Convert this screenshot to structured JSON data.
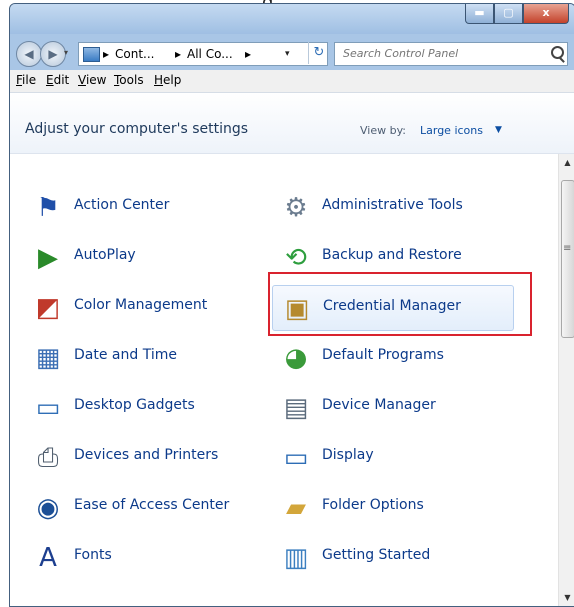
{
  "top_strip_text": "g",
  "window": {
    "buttons": {
      "minimize": "▬",
      "maximize": "▢",
      "close": "x"
    }
  },
  "address": {
    "back_icon": "back-arrow-icon",
    "forward_icon": "forward-arrow-icon",
    "crumbs": [
      "Cont...",
      "All Co..."
    ],
    "separator": "▸",
    "dropdown_arrow": "▾",
    "refresh_icon": "↻",
    "search_placeholder": "Search Control Panel"
  },
  "menu": [
    "File",
    "Edit",
    "View",
    "Tools",
    "Help"
  ],
  "header": {
    "title": "Adjust your computer's settings",
    "view_by_label": "View by:",
    "view_by_value": "Large icons",
    "view_by_arrow": "▼"
  },
  "items": [
    {
      "label": "Action Center",
      "icon": "flag-icon",
      "glyph": "⚑",
      "color": "#1f4fa8"
    },
    {
      "label": "Administrative Tools",
      "icon": "admin-tools-icon",
      "glyph": "⚙",
      "color": "#6b7c8f"
    },
    {
      "label": "AutoPlay",
      "icon": "autoplay-icon",
      "glyph": "▶",
      "color": "#2a8a2a"
    },
    {
      "label": "Backup and Restore",
      "icon": "backup-icon",
      "glyph": "⟲",
      "color": "#2e9e3e"
    },
    {
      "label": "Color Management",
      "icon": "color-management-icon",
      "glyph": "◩",
      "color": "#c0392b"
    },
    {
      "label": "Credential Manager",
      "icon": "credential-vault-icon",
      "glyph": "▣",
      "color": "#b58a2f"
    },
    {
      "label": "Date and Time",
      "icon": "calendar-clock-icon",
      "glyph": "▦",
      "color": "#3c6fb4"
    },
    {
      "label": "Default Programs",
      "icon": "default-programs-icon",
      "glyph": "◕",
      "color": "#3a9a3a"
    },
    {
      "label": "Desktop Gadgets",
      "icon": "gadgets-icon",
      "glyph": "▭",
      "color": "#2f6eb6"
    },
    {
      "label": "Device Manager",
      "icon": "device-manager-icon",
      "glyph": "▤",
      "color": "#5b6b7c"
    },
    {
      "label": "Devices and Printers",
      "icon": "printer-icon",
      "glyph": "⎙",
      "color": "#4f5d6d"
    },
    {
      "label": "Display",
      "icon": "display-icon",
      "glyph": "▭",
      "color": "#2d6db5"
    },
    {
      "label": "Ease of Access Center",
      "icon": "accessibility-icon",
      "glyph": "◉",
      "color": "#1c4f96"
    },
    {
      "label": "Folder Options",
      "icon": "folder-options-icon",
      "glyph": "▰",
      "color": "#d3a63a"
    },
    {
      "label": "Fonts",
      "icon": "fonts-icon",
      "glyph": "A",
      "color": "#1d3f8f"
    },
    {
      "label": "Getting Started",
      "icon": "getting-started-icon",
      "glyph": "▥",
      "color": "#3c7fc0"
    }
  ],
  "selected_item": "Credential Manager",
  "scrollbar": {
    "up": "▲",
    "down": "▼"
  }
}
